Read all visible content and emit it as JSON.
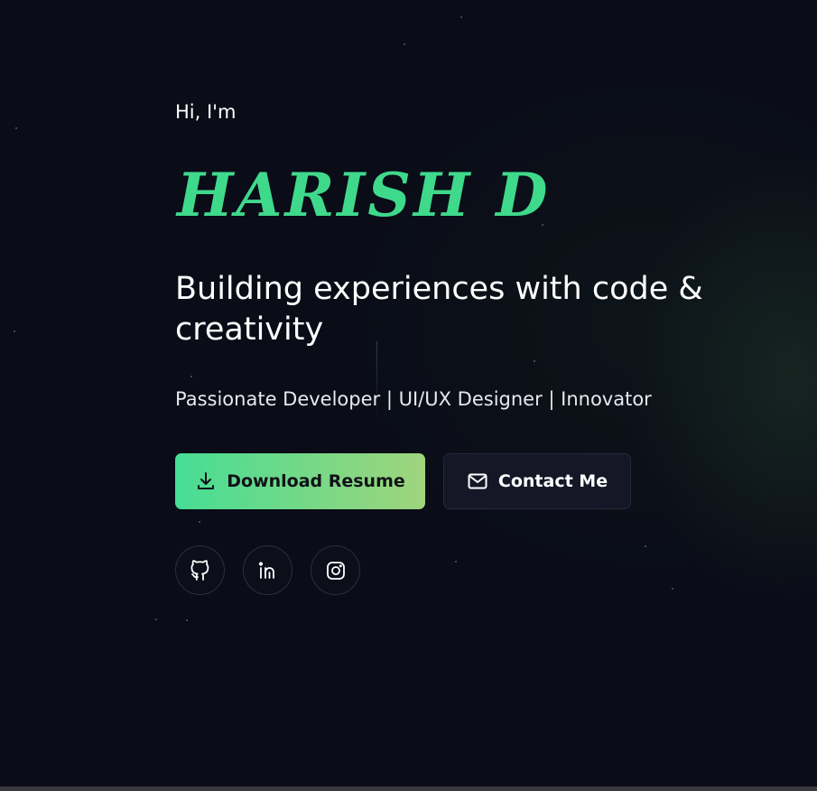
{
  "hero": {
    "greeting": "Hi, I'm",
    "name": "HARISH D",
    "tagline": "Building experiences with code & creativity",
    "roles": "Passionate Developer | UI/UX Designer | Innovator"
  },
  "actions": {
    "download_label": "Download Resume",
    "download_icon": "download-icon",
    "contact_label": "Contact Me",
    "contact_icon": "mail-icon"
  },
  "socials": [
    {
      "icon": "github-icon"
    },
    {
      "icon": "linkedin-icon"
    },
    {
      "icon": "instagram-icon"
    }
  ],
  "colors": {
    "background": "#0a0c17",
    "accent": "#3fd98c",
    "button_gradient_start": "#45dd94",
    "button_gradient_end": "#a0d47c",
    "secondary_button": "#151726"
  }
}
